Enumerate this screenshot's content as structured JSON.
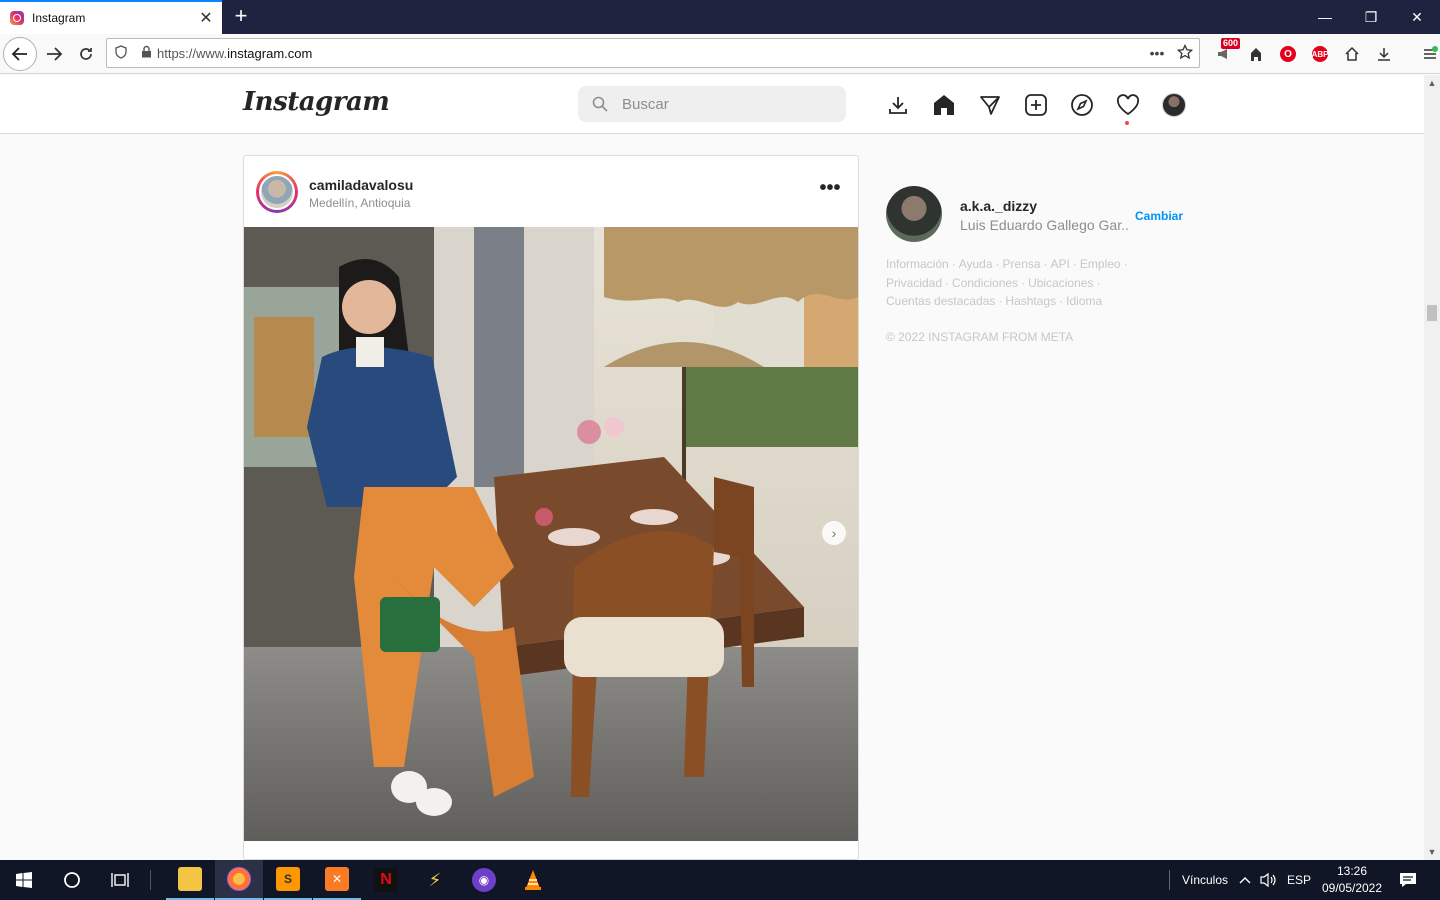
{
  "browser": {
    "tab_title": "Instagram",
    "tab_close": "✕",
    "new_tab": "+",
    "url_prefix": "https://www.",
    "url_domain": "instagram.com",
    "page_actions": "•••",
    "badge_count": "600",
    "abp_label": "ABP",
    "window_controls": {
      "minimize": "—",
      "restore": "❐",
      "close": "✕"
    }
  },
  "instagram": {
    "logo": "Instagram",
    "search_placeholder": "Buscar",
    "nav_icons": [
      "download-icon",
      "home-icon",
      "direct-icon",
      "new-post-icon",
      "explore-icon",
      "activity-heart-icon",
      "profile-avatar"
    ],
    "post": {
      "username": "camiladavalosu",
      "location": "Medellín, Antioquia",
      "more": "•••"
    },
    "sidebar": {
      "username": "a.k.a._dizzy",
      "full_name": "Luis Eduardo Gallego Gar...",
      "switch_label": "Cambiar",
      "footer_links": [
        "Información",
        "Ayuda",
        "Prensa",
        "API",
        "Empleo",
        "Privacidad",
        "Condiciones",
        "Ubicaciones",
        "Cuentas destacadas",
        "Hashtags",
        "Idioma"
      ],
      "copyright": "© 2022 INSTAGRAM FROM META"
    }
  },
  "taskbar": {
    "links_label": "Vínculos",
    "language": "ESP",
    "time": "13:26",
    "date": "09/05/2022",
    "apps": [
      "file-explorer",
      "firefox",
      "sublime-text",
      "xampp",
      "netflix",
      "thunderbolt-app",
      "github-desktop",
      "vlc"
    ]
  },
  "colors": {
    "accent": "#0095f6",
    "notification": "#ed4956",
    "tab_accent": "#0a84ff",
    "taskbar": "#101625"
  }
}
